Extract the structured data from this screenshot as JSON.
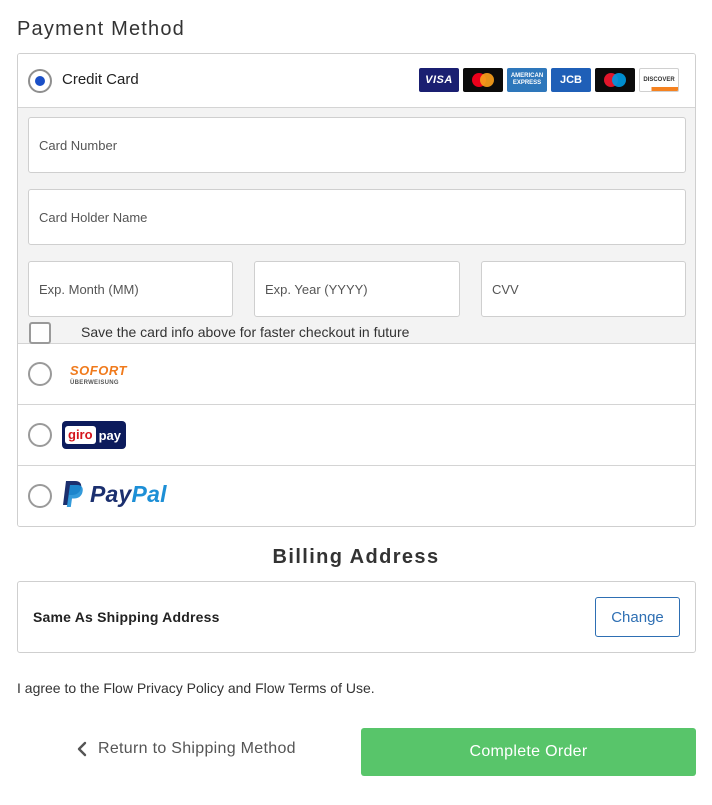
{
  "payment": {
    "title": "Payment Method",
    "credit_card": {
      "label": "Credit Card",
      "selected": true,
      "brands": [
        "visa",
        "mastercard",
        "american-express",
        "jcb",
        "maestro",
        "discover"
      ],
      "visa_text": "VISA",
      "amex_text": "AMERICAN EXPRESS",
      "jcb_text": "JCB",
      "discover_text": "DISCOVER",
      "card_number_placeholder": "Card Number",
      "holder_placeholder": "Card Holder Name",
      "month_placeholder": "Exp. Month (MM)",
      "year_placeholder": "Exp. Year (YYYY)",
      "cvv_placeholder": "CVV",
      "save_label": "Save the card info above for faster checkout in future"
    },
    "sofort": {
      "text": "SOFORT",
      "subtext": "ÜBERWEISUNG"
    },
    "giropay": {
      "text1": "giro",
      "text2": "pay"
    },
    "paypal": {
      "text1": "Pay",
      "text2": "Pal"
    }
  },
  "billing": {
    "title": "Billing Address",
    "same_as_shipping": "Same As Shipping Address",
    "change_label": "Change"
  },
  "agreement": "I agree to the Flow Privacy Policy and Flow Terms of Use.",
  "footer": {
    "back_label": "Return to Shipping Method",
    "complete_label": "Complete Order"
  },
  "colors": {
    "accent_blue": "#2e6fb3",
    "complete_green": "#58c56a",
    "radio_selected": "#1a4fc7"
  }
}
